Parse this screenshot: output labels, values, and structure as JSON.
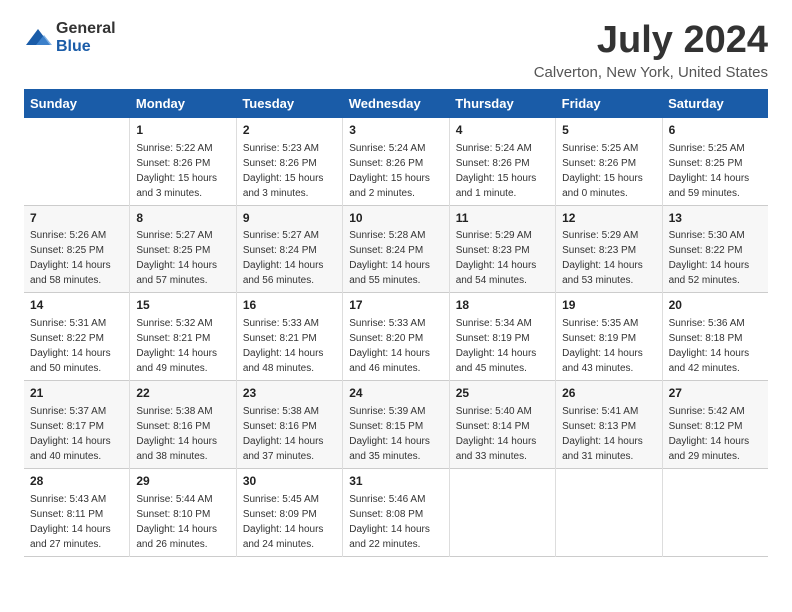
{
  "logo": {
    "general": "General",
    "blue": "Blue"
  },
  "header": {
    "title": "July 2024",
    "subtitle": "Calverton, New York, United States"
  },
  "calendar": {
    "days_of_week": [
      "Sunday",
      "Monday",
      "Tuesday",
      "Wednesday",
      "Thursday",
      "Friday",
      "Saturday"
    ],
    "weeks": [
      [
        {
          "day": "",
          "content": ""
        },
        {
          "day": "1",
          "content": "Sunrise: 5:22 AM\nSunset: 8:26 PM\nDaylight: 15 hours\nand 3 minutes."
        },
        {
          "day": "2",
          "content": "Sunrise: 5:23 AM\nSunset: 8:26 PM\nDaylight: 15 hours\nand 3 minutes."
        },
        {
          "day": "3",
          "content": "Sunrise: 5:24 AM\nSunset: 8:26 PM\nDaylight: 15 hours\nand 2 minutes."
        },
        {
          "day": "4",
          "content": "Sunrise: 5:24 AM\nSunset: 8:26 PM\nDaylight: 15 hours\nand 1 minute."
        },
        {
          "day": "5",
          "content": "Sunrise: 5:25 AM\nSunset: 8:26 PM\nDaylight: 15 hours\nand 0 minutes."
        },
        {
          "day": "6",
          "content": "Sunrise: 5:25 AM\nSunset: 8:25 PM\nDaylight: 14 hours\nand 59 minutes."
        }
      ],
      [
        {
          "day": "7",
          "content": "Sunrise: 5:26 AM\nSunset: 8:25 PM\nDaylight: 14 hours\nand 58 minutes."
        },
        {
          "day": "8",
          "content": "Sunrise: 5:27 AM\nSunset: 8:25 PM\nDaylight: 14 hours\nand 57 minutes."
        },
        {
          "day": "9",
          "content": "Sunrise: 5:27 AM\nSunset: 8:24 PM\nDaylight: 14 hours\nand 56 minutes."
        },
        {
          "day": "10",
          "content": "Sunrise: 5:28 AM\nSunset: 8:24 PM\nDaylight: 14 hours\nand 55 minutes."
        },
        {
          "day": "11",
          "content": "Sunrise: 5:29 AM\nSunset: 8:23 PM\nDaylight: 14 hours\nand 54 minutes."
        },
        {
          "day": "12",
          "content": "Sunrise: 5:29 AM\nSunset: 8:23 PM\nDaylight: 14 hours\nand 53 minutes."
        },
        {
          "day": "13",
          "content": "Sunrise: 5:30 AM\nSunset: 8:22 PM\nDaylight: 14 hours\nand 52 minutes."
        }
      ],
      [
        {
          "day": "14",
          "content": "Sunrise: 5:31 AM\nSunset: 8:22 PM\nDaylight: 14 hours\nand 50 minutes."
        },
        {
          "day": "15",
          "content": "Sunrise: 5:32 AM\nSunset: 8:21 PM\nDaylight: 14 hours\nand 49 minutes."
        },
        {
          "day": "16",
          "content": "Sunrise: 5:33 AM\nSunset: 8:21 PM\nDaylight: 14 hours\nand 48 minutes."
        },
        {
          "day": "17",
          "content": "Sunrise: 5:33 AM\nSunset: 8:20 PM\nDaylight: 14 hours\nand 46 minutes."
        },
        {
          "day": "18",
          "content": "Sunrise: 5:34 AM\nSunset: 8:19 PM\nDaylight: 14 hours\nand 45 minutes."
        },
        {
          "day": "19",
          "content": "Sunrise: 5:35 AM\nSunset: 8:19 PM\nDaylight: 14 hours\nand 43 minutes."
        },
        {
          "day": "20",
          "content": "Sunrise: 5:36 AM\nSunset: 8:18 PM\nDaylight: 14 hours\nand 42 minutes."
        }
      ],
      [
        {
          "day": "21",
          "content": "Sunrise: 5:37 AM\nSunset: 8:17 PM\nDaylight: 14 hours\nand 40 minutes."
        },
        {
          "day": "22",
          "content": "Sunrise: 5:38 AM\nSunset: 8:16 PM\nDaylight: 14 hours\nand 38 minutes."
        },
        {
          "day": "23",
          "content": "Sunrise: 5:38 AM\nSunset: 8:16 PM\nDaylight: 14 hours\nand 37 minutes."
        },
        {
          "day": "24",
          "content": "Sunrise: 5:39 AM\nSunset: 8:15 PM\nDaylight: 14 hours\nand 35 minutes."
        },
        {
          "day": "25",
          "content": "Sunrise: 5:40 AM\nSunset: 8:14 PM\nDaylight: 14 hours\nand 33 minutes."
        },
        {
          "day": "26",
          "content": "Sunrise: 5:41 AM\nSunset: 8:13 PM\nDaylight: 14 hours\nand 31 minutes."
        },
        {
          "day": "27",
          "content": "Sunrise: 5:42 AM\nSunset: 8:12 PM\nDaylight: 14 hours\nand 29 minutes."
        }
      ],
      [
        {
          "day": "28",
          "content": "Sunrise: 5:43 AM\nSunset: 8:11 PM\nDaylight: 14 hours\nand 27 minutes."
        },
        {
          "day": "29",
          "content": "Sunrise: 5:44 AM\nSunset: 8:10 PM\nDaylight: 14 hours\nand 26 minutes."
        },
        {
          "day": "30",
          "content": "Sunrise: 5:45 AM\nSunset: 8:09 PM\nDaylight: 14 hours\nand 24 minutes."
        },
        {
          "day": "31",
          "content": "Sunrise: 5:46 AM\nSunset: 8:08 PM\nDaylight: 14 hours\nand 22 minutes."
        },
        {
          "day": "",
          "content": ""
        },
        {
          "day": "",
          "content": ""
        },
        {
          "day": "",
          "content": ""
        }
      ]
    ]
  }
}
